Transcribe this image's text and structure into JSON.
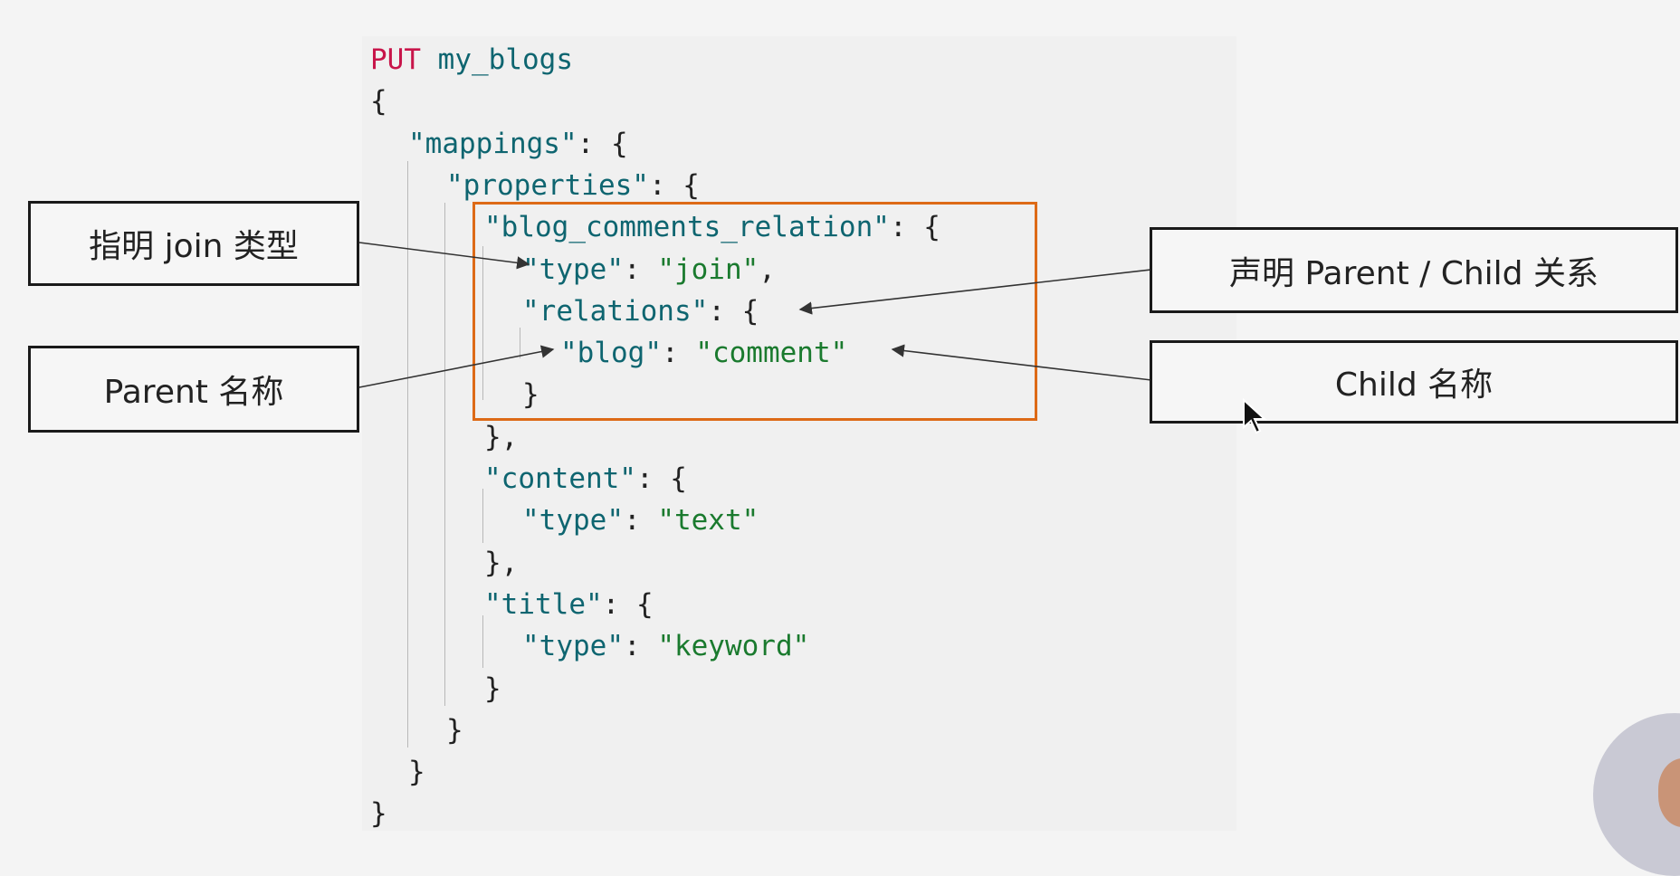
{
  "code": {
    "lines": [
      {
        "indent": 0,
        "tokens": [
          {
            "t": "PUT",
            "c": "kw"
          },
          {
            "t": " ",
            "c": "pun"
          },
          {
            "t": "my_blogs",
            "c": "id"
          }
        ]
      },
      {
        "indent": 0,
        "tokens": [
          {
            "t": "{",
            "c": "pun"
          }
        ]
      },
      {
        "indent": 1,
        "tokens": [
          {
            "t": "\"mappings\"",
            "c": "key"
          },
          {
            "t": ": {",
            "c": "pun"
          }
        ]
      },
      {
        "indent": 2,
        "tokens": [
          {
            "t": "\"properties\"",
            "c": "key"
          },
          {
            "t": ": {",
            "c": "pun"
          }
        ]
      },
      {
        "indent": 3,
        "tokens": [
          {
            "t": "\"blog_comments_relation\"",
            "c": "key"
          },
          {
            "t": ": {",
            "c": "pun"
          }
        ]
      },
      {
        "indent": 4,
        "tokens": [
          {
            "t": "\"type\"",
            "c": "key"
          },
          {
            "t": ": ",
            "c": "pun"
          },
          {
            "t": "\"join\"",
            "c": "str"
          },
          {
            "t": ",",
            "c": "pun"
          }
        ]
      },
      {
        "indent": 4,
        "tokens": [
          {
            "t": "\"relations\"",
            "c": "key"
          },
          {
            "t": ": {",
            "c": "pun"
          }
        ]
      },
      {
        "indent": 5,
        "tokens": [
          {
            "t": "\"blog\"",
            "c": "key"
          },
          {
            "t": ": ",
            "c": "pun"
          },
          {
            "t": "\"comment\"",
            "c": "str"
          }
        ]
      },
      {
        "indent": 4,
        "tokens": [
          {
            "t": "}",
            "c": "pun"
          }
        ]
      },
      {
        "indent": 3,
        "tokens": [
          {
            "t": "},",
            "c": "pun"
          }
        ]
      },
      {
        "indent": 3,
        "tokens": [
          {
            "t": "\"content\"",
            "c": "key"
          },
          {
            "t": ": {",
            "c": "pun"
          }
        ]
      },
      {
        "indent": 4,
        "tokens": [
          {
            "t": "\"type\"",
            "c": "key"
          },
          {
            "t": ": ",
            "c": "pun"
          },
          {
            "t": "\"text\"",
            "c": "str"
          }
        ]
      },
      {
        "indent": 3,
        "tokens": [
          {
            "t": "},",
            "c": "pun"
          }
        ]
      },
      {
        "indent": 3,
        "tokens": [
          {
            "t": "\"title\"",
            "c": "key"
          },
          {
            "t": ": {",
            "c": "pun"
          }
        ]
      },
      {
        "indent": 4,
        "tokens": [
          {
            "t": "\"type\"",
            "c": "key"
          },
          {
            "t": ": ",
            "c": "pun"
          },
          {
            "t": "\"keyword\"",
            "c": "str"
          }
        ]
      },
      {
        "indent": 3,
        "tokens": [
          {
            "t": "}",
            "c": "pun"
          }
        ]
      },
      {
        "indent": 2,
        "tokens": [
          {
            "t": "}",
            "c": "pun"
          }
        ]
      },
      {
        "indent": 1,
        "tokens": [
          {
            "t": "}",
            "c": "pun"
          }
        ]
      },
      {
        "indent": 0,
        "tokens": [
          {
            "t": "}",
            "c": "pun"
          }
        ]
      }
    ]
  },
  "callouts": {
    "join_type": "指明 join 类型",
    "parent_name": "Parent 名称",
    "declare_relation": "声明 Parent / Child 关系",
    "child_name": "Child 名称"
  },
  "colors": {
    "highlight_border": "#dd6a17",
    "keyword": "#c8154a",
    "property_key": "#0e6570",
    "string_value": "#1a7a2e"
  }
}
